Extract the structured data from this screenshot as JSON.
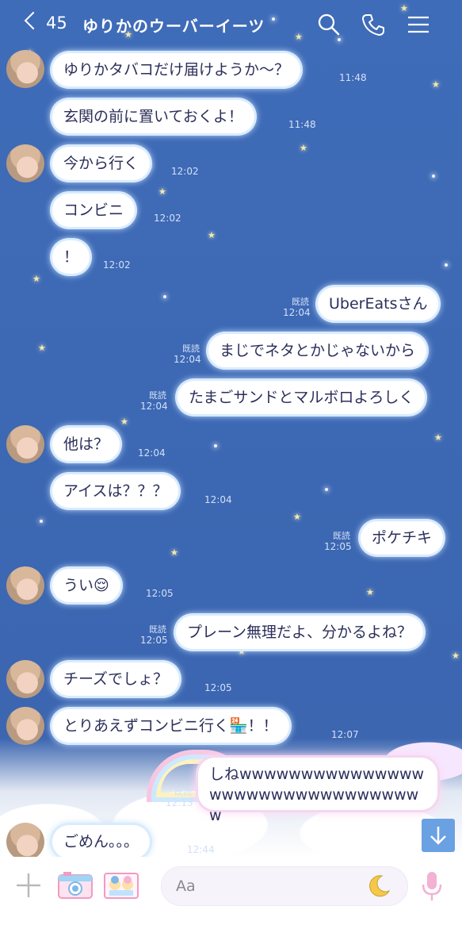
{
  "header": {
    "back_count": "45",
    "title": "ゆりかのウーバーイーツ"
  },
  "icons": {
    "back": "chevron-left-icon",
    "search": "search-icon",
    "call": "phone-icon",
    "menu": "hamburger-menu-icon",
    "scroll": "arrow-down-icon",
    "add": "plus-icon",
    "camera": "camera-icon",
    "photo": "photo-icon",
    "emoji": "moon-emoji-icon",
    "mic": "microphone-icon"
  },
  "colors": {
    "background": "#3f6cb8",
    "bubble_text": "#2b2f5a",
    "timestamp": "#d3e0f6",
    "scroll_button": "#6aa1e3"
  },
  "messages": [
    {
      "side": "in",
      "text": "ゆりかタバコだけ届けようか〜？",
      "time": "11:48"
    },
    {
      "side": "in",
      "text": "玄関の前に置いておくよ！",
      "time": "11:48"
    },
    {
      "side": "in",
      "text": "今から行く",
      "time": "12:02"
    },
    {
      "side": "in",
      "text": "コンビニ",
      "time": "12:02"
    },
    {
      "side": "in",
      "text": "！",
      "time": "12:02"
    },
    {
      "side": "out",
      "text": "UberEatsさん",
      "time": "12:04",
      "read": "既読"
    },
    {
      "side": "out",
      "text": "まじでネタとかじゃないから",
      "time": "12:04",
      "read": "既読"
    },
    {
      "side": "out",
      "text": "たまごサンドとマルボロよろしく",
      "time": "12:04",
      "read": "既読"
    },
    {
      "side": "in",
      "text": "他は？",
      "time": "12:04"
    },
    {
      "side": "in",
      "text": "アイスは？？？",
      "time": "12:04"
    },
    {
      "side": "out",
      "text": "ポケチキ",
      "time": "12:05",
      "read": "既読"
    },
    {
      "side": "in",
      "text": "うい😌",
      "time": "12:05"
    },
    {
      "side": "out",
      "text": "プレーン無理だよ、分かるよね？",
      "time": "12:05",
      "read": "既読"
    },
    {
      "side": "in",
      "text": "チーズでしょ？",
      "time": "12:05"
    },
    {
      "side": "in",
      "text": "とりあえずコンビニ行く🏪！！",
      "time": "12:07"
    },
    {
      "side": "out",
      "text": "しねwwwwwwwwwwwwwwwwwwwwwwwwwwwwwwwww",
      "time": "12:13",
      "read": "既読"
    },
    {
      "side": "in",
      "text": "ごめん。。。",
      "time": "12:44"
    }
  ],
  "input": {
    "placeholder": "Aa"
  }
}
